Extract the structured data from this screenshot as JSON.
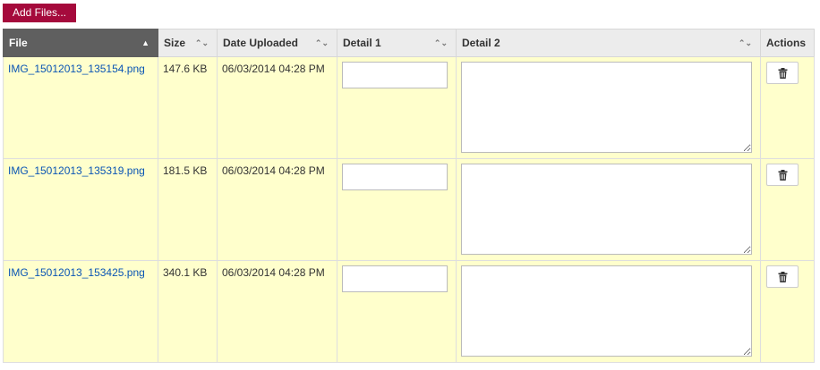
{
  "toolbar": {
    "add_files_label": "Add Files..."
  },
  "columns": [
    {
      "label": "File",
      "sort": "▲"
    },
    {
      "label": "Size",
      "sort": "⌃⌄"
    },
    {
      "label": "Date Uploaded",
      "sort": "⌃⌄"
    },
    {
      "label": "Detail 1",
      "sort": "⌃⌄"
    },
    {
      "label": "Detail 2",
      "sort": "⌃⌄"
    },
    {
      "label": "Actions",
      "sort": ""
    }
  ],
  "rows": [
    {
      "file": "IMG_15012013_135154.png",
      "size": "147.6 KB",
      "date": "06/03/2014 04:28 PM",
      "detail1": "",
      "detail2": ""
    },
    {
      "file": "IMG_15012013_135319.png",
      "size": "181.5 KB",
      "date": "06/03/2014 04:28 PM",
      "detail1": "",
      "detail2": ""
    },
    {
      "file": "IMG_15012013_153425.png",
      "size": "340.1 KB",
      "date": "06/03/2014 04:28 PM",
      "detail1": "",
      "detail2": ""
    }
  ],
  "icons": {
    "delete": "trash-icon"
  },
  "colors": {
    "brand": "#a50a3c",
    "row_bg": "#ffffcc",
    "link": "#0a55b4",
    "active_header": "#5f5f5f"
  }
}
